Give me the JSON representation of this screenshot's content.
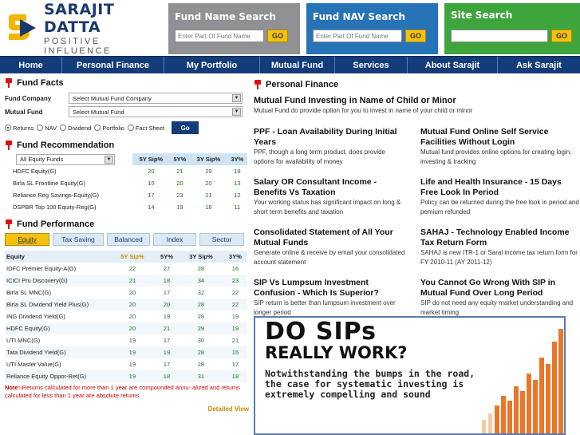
{
  "logo": {
    "name": "SARAJIT DATTA",
    "tagline": "POSITIVE INFLUENCE"
  },
  "search": {
    "fund_name": {
      "title": "Fund Name Search",
      "placeholder": "Enter Part Of Fund Name",
      "go": "GO",
      "color": "#8f9194"
    },
    "fund_nav": {
      "title": "Fund NAV Search",
      "placeholder": "Enter Part Of Fund Name",
      "go": "GO",
      "color": "#2673b7"
    },
    "site": {
      "title": "Site Search",
      "placeholder": "",
      "go": "GO",
      "color": "#3ea53c"
    }
  },
  "nav": [
    "Home",
    "Personal Finance",
    "My Portfolio",
    "Mutual Fund",
    "Services",
    "About Sarajit",
    "Ask Sarajit"
  ],
  "fund_facts": {
    "title": "Fund Facts",
    "company_label": "Fund Company",
    "company_value": "Select Mutual Fund Company",
    "fund_label": "Mutual Fund",
    "fund_value": "Select Mutual Fund",
    "radios": [
      "Returns",
      "NAV",
      "Dividend",
      "Portfolio",
      "Fact Sheet"
    ],
    "go": "Go"
  },
  "recommendation": {
    "title": "Fund Recommendation",
    "filter": "All Equity Funds",
    "cols": [
      "5Y Sip%",
      "5Y%",
      "3Y Sip%",
      "3Y%"
    ],
    "rows": [
      {
        "name": "HDFC Equity(G)",
        "v": [
          "20",
          "21",
          "29",
          "19"
        ]
      },
      {
        "name": "Birla SL Frontline Equity(G)",
        "v": [
          "15",
          "20",
          "20",
          "13"
        ]
      },
      {
        "name": "Reliance Reg Savings-Equity(G)",
        "v": [
          "17",
          "23",
          "21",
          "12"
        ]
      },
      {
        "name": "DSPBR Top 100 Equity-Reg(G)",
        "v": [
          "14",
          "19",
          "18",
          "11"
        ]
      }
    ]
  },
  "performance": {
    "title": "Fund Performance",
    "tabs": [
      "Equity",
      "Tax Saving",
      "Balanced",
      "Index",
      "Sector"
    ],
    "head": [
      "Equity",
      "5Y Sip%",
      "5Y%",
      "3Y Sip%",
      "3Y%"
    ],
    "rows": [
      {
        "name": "IDFC Premier Equity-A(G)",
        "v": [
          "22",
          "27",
          "28",
          "16"
        ]
      },
      {
        "name": "ICICI Pru Discovery(G)",
        "v": [
          "21",
          "18",
          "34",
          "23"
        ]
      },
      {
        "name": "Birla SL MNC(G)",
        "v": [
          "20",
          "17",
          "32",
          "22"
        ]
      },
      {
        "name": "Birla SL Dividend Yield Plus(G)",
        "v": [
          "20",
          "20",
          "28",
          "22"
        ]
      },
      {
        "name": "ING Dividend Yield(G)",
        "v": [
          "20",
          "19",
          "28",
          "19"
        ]
      },
      {
        "name": "HDFC Equity(G)",
        "v": [
          "20",
          "21",
          "29",
          "19"
        ]
      },
      {
        "name": "UTI MNC(G)",
        "v": [
          "19",
          "17",
          "30",
          "21"
        ]
      },
      {
        "name": "Tata Dividend Yield(G)",
        "v": [
          "19",
          "19",
          "28",
          "15"
        ]
      },
      {
        "name": "UTI Master Value(G)",
        "v": [
          "19",
          "17",
          "28",
          "17"
        ]
      },
      {
        "name": "Reliance Equity Oppor-Ret(G)",
        "v": [
          "19",
          "18",
          "31",
          "18"
        ]
      }
    ],
    "note_label": "Note:-",
    "note": "Returns calculated for more than 1 year are compounded annu- alized and returns calculated for less than 1 year are absolute returns",
    "detailed": "Detailed View"
  },
  "personal_finance": {
    "title": "Personal Finance",
    "lead": {
      "title": "Mutual Fund Investing in Name of Child or Minor",
      "desc": "Mutual Fund do provide option for you to invest in name of your child or minor"
    },
    "left": [
      {
        "title": "PPF - Loan Availability During Initial Years",
        "desc": "PPF, though a long term product, does provide options for availability of money"
      },
      {
        "title": "Salary OR Consultant Income - Benefits Vs Taxation",
        "desc": "Your working status has significant impact on long & short term benefits and taxation"
      },
      {
        "title": "Consolidated Statement of All Your Mutual Funds",
        "desc": "Generate online & receive by email your consolidated account statement"
      },
      {
        "title": "SIP Vs Lumpsum Investment Confusion - Which Is Superior?",
        "desc": "SIP return is better than lumpsum investment over longer period"
      }
    ],
    "right": [
      {
        "title": "Mutual Fund Online Self Service Facilities Without Login",
        "desc": "Mutual fund provides online options for creating login, investing & tracking"
      },
      {
        "title": "Life and Health Insurance - 15 Days Free Look In Period",
        "desc": "Policy can be returned during the free look in period and pemium refunded"
      },
      {
        "title": "SAHAJ - Technology Enabled Income Tax Return Form",
        "desc": "SAHAJ is new ITR-1 or Saral income tax return form for FY 2010-11 (AY 2011-12)"
      },
      {
        "title": "You Cannot Go Wrong With SIP in Mutual Fund Over Long Period",
        "desc": "SIP do not need any equity market understanding and market timing"
      }
    ]
  },
  "banner": {
    "title1": "DO SIPs",
    "title2": "REALLY WORK?",
    "sub": "Notwithstanding the bumps in the road, the case for systematic investing is extremely compelling and sound"
  }
}
